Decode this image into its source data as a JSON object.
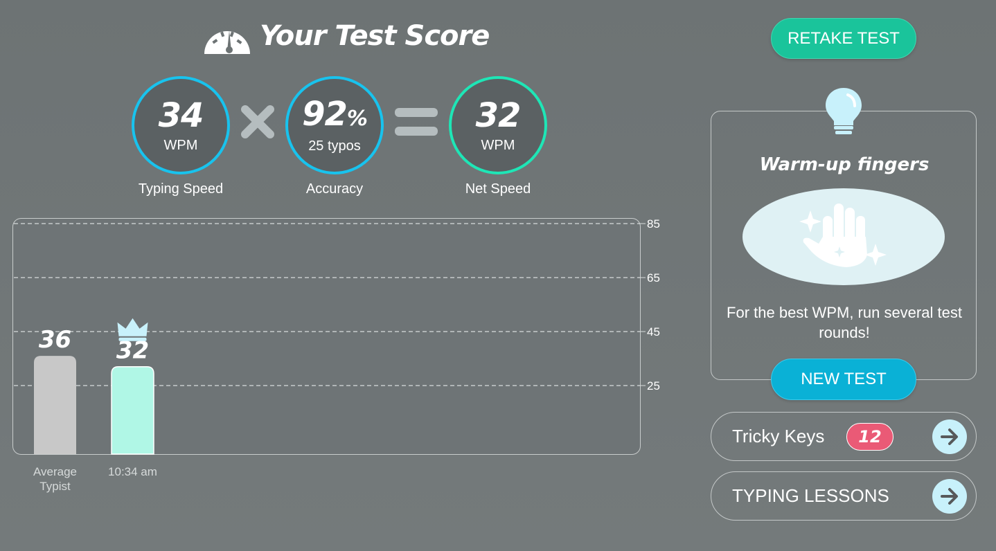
{
  "header": {
    "title": "Your Test Score",
    "icon": "speedometer-icon"
  },
  "stats": {
    "typing_speed": {
      "value": "34",
      "unit": "WPM",
      "label": "Typing Speed"
    },
    "accuracy": {
      "value": "92",
      "percent_sign": "%",
      "sub": "25 typos",
      "label": "Accuracy"
    },
    "net_speed": {
      "value": "32",
      "unit": "WPM",
      "label": "Net Speed"
    }
  },
  "colors": {
    "cyan_ring": "#18c3ee",
    "green_ring": "#1ee6b6",
    "retake_bg": "#1ac49b",
    "newtest_bg": "#0ab1d6",
    "badge_bg": "#ea5a76",
    "average_bar": "#c8c8c8",
    "user_bar": "#b0f7e6"
  },
  "chart_data": {
    "type": "bar",
    "categories": [
      "Average Typist",
      "10:34 am"
    ],
    "values": [
      36,
      32
    ],
    "data_labels": [
      "36",
      "32"
    ],
    "yticks": [
      25,
      45,
      65,
      85
    ],
    "ylim": [
      0,
      85
    ],
    "grid": "dashed horizontal",
    "highlight": {
      "index": 1,
      "icon": "crown-icon"
    }
  },
  "actions": {
    "retake_label": "RETAKE TEST",
    "new_test_label": "NEW TEST"
  },
  "tip": {
    "icon": "lightbulb-icon",
    "title": "Warm-up fingers",
    "illustration": "sparkle-hand-icon",
    "text": "For the best WPM, run several test rounds!"
  },
  "tricky_keys": {
    "label": "Tricky Keys",
    "count": "12"
  },
  "typing_lessons": {
    "label": "TYPING LESSONS"
  }
}
